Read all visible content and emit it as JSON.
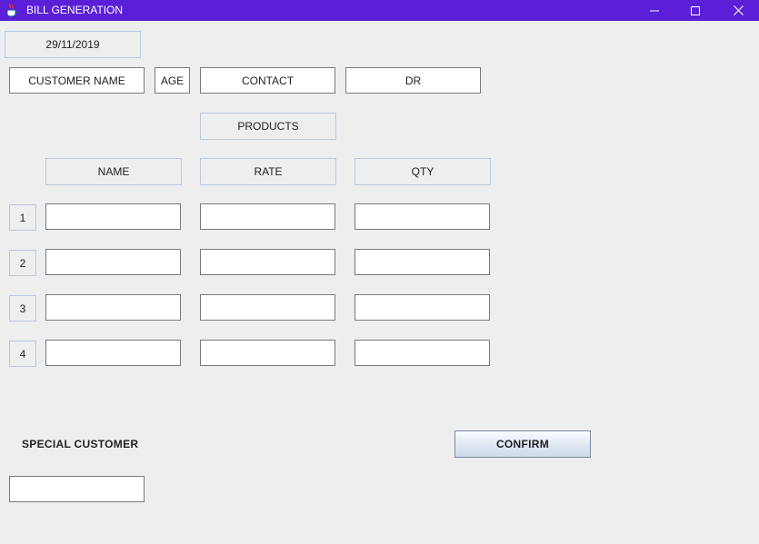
{
  "window": {
    "title": "BILL GENERATION",
    "titlebar_color": "#5a1fd6",
    "icons": {
      "app": "java-cup-icon",
      "minimize": "minimize-icon",
      "maximize": "maximize-icon",
      "close": "close-icon"
    }
  },
  "header": {
    "date": "29/11/2019"
  },
  "customer": {
    "name_label": "CUSTOMER NAME",
    "age_label": "AGE",
    "contact_label": "CONTACT",
    "dr_label": "DR"
  },
  "products": {
    "section_label": "PRODUCTS",
    "columns": [
      "NAME",
      "RATE",
      "QTY"
    ],
    "rows": [
      {
        "index": "1",
        "name": "",
        "rate": "",
        "qty": ""
      },
      {
        "index": "2",
        "name": "",
        "rate": "",
        "qty": ""
      },
      {
        "index": "3",
        "name": "",
        "rate": "",
        "qty": ""
      },
      {
        "index": "4",
        "name": "",
        "rate": "",
        "qty": ""
      }
    ]
  },
  "special": {
    "label": "SPECIAL CUSTOMER",
    "value": ""
  },
  "actions": {
    "confirm_label": "CONFIRM"
  }
}
